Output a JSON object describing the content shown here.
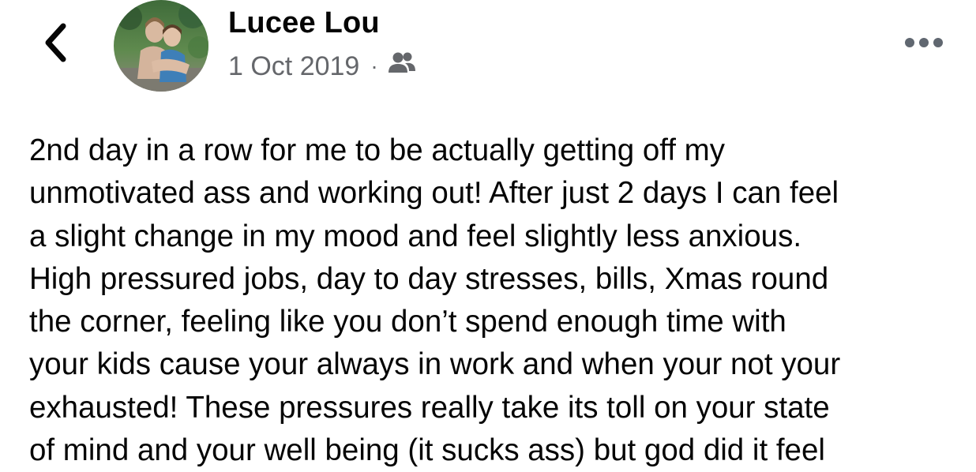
{
  "header": {
    "back_icon": "chevron-left-icon",
    "author_name": "Lucee Lou",
    "date": "1 Oct 2019",
    "separator": "·",
    "audience_icon": "friends-icon",
    "more_icon": "more-horizontal-icon"
  },
  "post": {
    "lines": [
      "2nd day in a row for me to be actually getting off my",
      "unmotivated ass and working out! After just 2 days I can feel",
      "a slight change in my mood and feel slightly less anxious.",
      "High pressured jobs, day to day stresses, bills, Xmas round",
      "the corner, feeling like you don’t spend enough time with",
      "your kids cause your always in work and when your not your",
      "exhausted! These pressures really take its toll on your state",
      "of mind and your well being (it sucks ass) but god did it feel"
    ]
  },
  "colors": {
    "text_primary": "#050505",
    "text_secondary": "#65676b",
    "icon": "#1c1e21",
    "background": "#ffffff"
  }
}
